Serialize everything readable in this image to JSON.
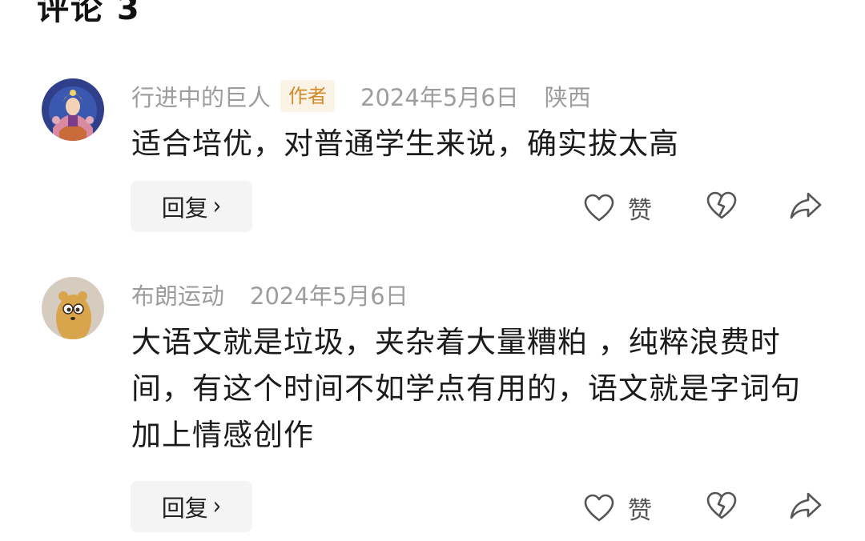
{
  "header": {
    "title": "评论 3"
  },
  "comments": [
    {
      "username": "行进中的巨人",
      "badge": "作者",
      "date": "2024年5月6日",
      "location": "陕西",
      "text": "适合培优，对普通学生来说，确实拔太高",
      "reply_label": "回复",
      "like_label": "赞",
      "avatar_icon": "ornate-figure-avatar"
    },
    {
      "username": "布朗运动",
      "date": "2024年5月6日",
      "text": "大语文就是垃圾，夹杂着大量糟粕 ，纯粹浪费时间，有这个时间不如学点有用的，语文就是字词句加上情感创作",
      "reply_label": "回复",
      "like_label": "赞",
      "avatar_icon": "cartoon-bear-avatar"
    }
  ],
  "icons": {
    "like": "heart-icon",
    "dislike": "broken-heart-icon",
    "share": "share-arrow-icon",
    "reply_chevron": "chevron-right-icon"
  },
  "colors": {
    "badge_bg": "#fbf3e6",
    "badge_text": "#d08a2a",
    "meta_text": "#9d9d9d",
    "body_text": "#1b1b1b",
    "reply_bg": "#f4f4f4"
  }
}
